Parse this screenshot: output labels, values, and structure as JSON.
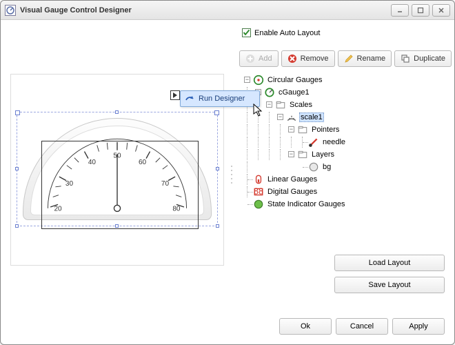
{
  "window": {
    "title": "Visual Gauge Control Designer"
  },
  "auto_layout": {
    "label": "Enable Auto Layout",
    "checked": true
  },
  "toolbar": {
    "add": "Add",
    "remove": "Remove",
    "rename": "Rename",
    "duplicate": "Duplicate"
  },
  "tree": {
    "circular": "Circular Gauges",
    "cgauge1": "cGauge1",
    "scales": "Scales",
    "scale1": "scale1",
    "pointers": "Pointers",
    "needle": "needle",
    "layers": "Layers",
    "bg": "bg",
    "linear": "Linear Gauges",
    "digital": "Digital Gauges",
    "state": "State Indicator Gauges"
  },
  "smart_tag": {
    "run_designer": "Run Designer"
  },
  "gauge": {
    "ticks": [
      "20",
      "30",
      "40",
      "50",
      "60",
      "70",
      "80"
    ]
  },
  "layout_buttons": {
    "load": "Load Layout",
    "save": "Save Layout"
  },
  "dialog_buttons": {
    "ok": "Ok",
    "cancel": "Cancel",
    "apply": "Apply"
  }
}
